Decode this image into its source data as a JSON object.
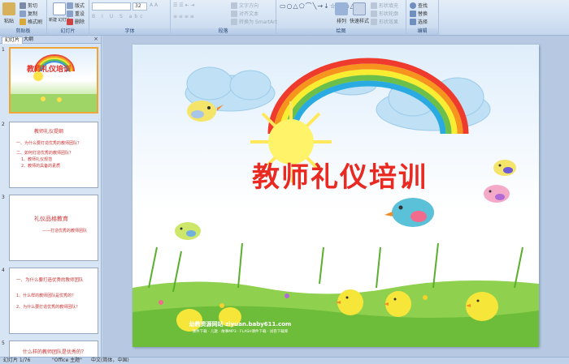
{
  "ribbon": {
    "clipboard": {
      "paste": "粘贴",
      "cut": "剪切",
      "copy": "复制",
      "format_painter": "格式刷",
      "label": "剪贴板"
    },
    "slides": {
      "new_slide": "新建\n幻灯片",
      "layout": "版式",
      "reset": "重设",
      "delete": "删除",
      "label": "幻灯片"
    },
    "font": {
      "font_size": "32",
      "label": "字体"
    },
    "paragraph": {
      "text_direction": "文字方向",
      "align_text": "对齐文本",
      "convert_smartart": "转换为 SmartArt",
      "label": "段落"
    },
    "drawing": {
      "arrange": "排列",
      "quick_styles": "快速样式",
      "shape_fill": "形状填充",
      "shape_outline": "形状轮廓",
      "shape_effects": "形状效果",
      "label": "绘图"
    },
    "editing": {
      "find": "查找",
      "replace": "替换",
      "select": "选择",
      "label": "编辑"
    }
  },
  "left_panel": {
    "tabs": [
      "幻灯片",
      "大纲"
    ],
    "close": "×",
    "thumbnails": [
      {
        "number": "1",
        "title": "教师礼仪培训"
      },
      {
        "number": "2",
        "title": "教师礼仪提纲",
        "lines": [
          "一、为什么要打造优秀的教师团队？",
          "二、如何打造优秀的教师团队？",
          "1、教师礼仪规范",
          "2、教师的具备的素质"
        ]
      },
      {
        "number": "3",
        "title": "礼仪品格教育",
        "lines": [
          "——打造优秀的教师团队"
        ]
      },
      {
        "number": "4",
        "lines": [
          "一、为什么要打造优秀的教师团队",
          "1、什么样的教师团队是优秀的？",
          "2、为什么要打造优秀的教师团队？"
        ]
      },
      {
        "number": "5",
        "lines": [
          "什么样的教师团队是优秀的？"
        ]
      }
    ]
  },
  "slide": {
    "title": "教师礼仪培训",
    "footer_site": "幼教资源网站 ziyuan.baby611.com",
    "footer_links": "课件下载 · 儿歌 · 故事MP3 · FLASH课件下载 · 试卷下载库"
  },
  "statusbar": {
    "slide_counter": "幻灯片 1/76",
    "theme": "\"Office 主题\"",
    "language": "中文(简体，中国)"
  },
  "colors": {
    "title_red": "#e82a22",
    "ribbon_bg": "#cfdff1",
    "selected_thumb": "#f0a43a",
    "grass_green": "#8fd14f"
  }
}
